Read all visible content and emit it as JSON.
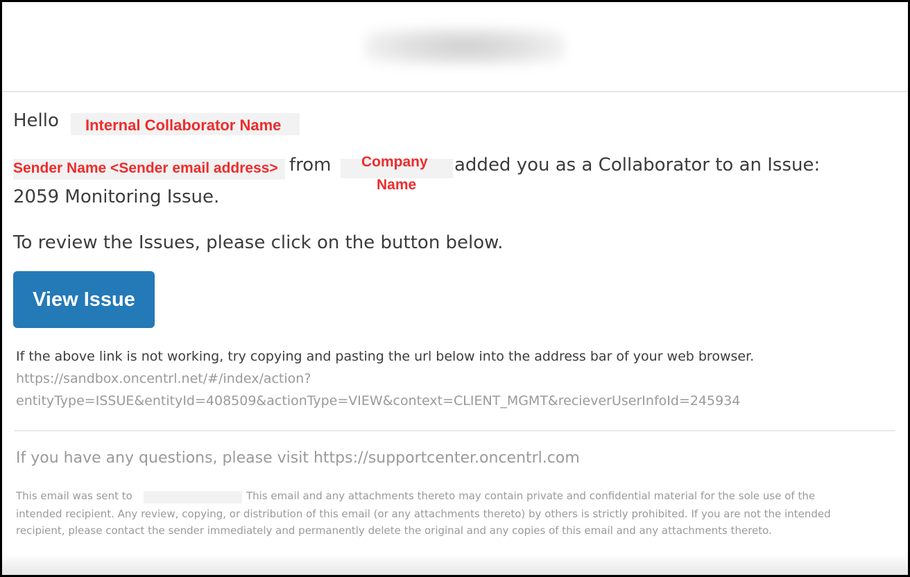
{
  "greeting": {
    "hello": "Hello",
    "recipient_name": "Internal Collaborator Name"
  },
  "message": {
    "sender": "Sender Name <Sender email address>",
    "from": "from",
    "company_line1": "Company",
    "company_line2": "Name",
    "added_text": "added you as a Collaborator to an Issue:",
    "issue_name": "2059 Monitoring Issue.",
    "review_instruction": "To review the Issues, please click on the button below."
  },
  "button": {
    "label": "View Issue"
  },
  "fallback": {
    "note": "If the above link is not working, try copying and pasting the url below into the address bar of your web browser.",
    "url_line1": "https://sandbox.oncentrl.net/#/index/action?",
    "url_line2": "entityType=ISSUE&entityId=408509&actionType=VIEW&context=CLIENT_MGMT&recieverUserInfoId=245934"
  },
  "support": {
    "text": "If you have any questions, please visit https://supportcenter.oncentrl.com"
  },
  "legal": {
    "sent_to": "This email was sent to",
    "line1_rest": "This email and any attachments thereto may contain private and confidential material for the sole use of the",
    "line2": "intended recipient. Any review, copying, or distribution of this email (or any attachments thereto) by others is strictly prohibited. If you are not the intended",
    "line3": "recipient, please contact the sender immediately and permanently delete the original and any copies of this email and any attachments thereto."
  },
  "colors": {
    "annotation_red": "#ee2c2c",
    "button_blue": "#2479b7",
    "body_text": "#3c3c3c",
    "muted_text": "#9a9a9a"
  }
}
